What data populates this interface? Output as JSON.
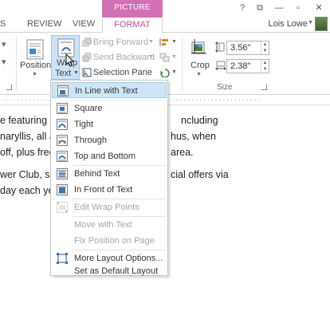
{
  "window": {
    "context_group": "PICTURE TOOLS",
    "controls": {
      "help": "?",
      "restore": "⧉",
      "minimize": "—",
      "maximize": "▫",
      "close": "✕"
    },
    "user_name": "Lois Lowe"
  },
  "tabs": {
    "review": "REVIEW",
    "view": "VIEW",
    "format": "FORMAT"
  },
  "ribbon": {
    "position_label": "Position",
    "wrap_text_line1": "Wrap",
    "wrap_text_line2": "Text",
    "bring_forward": "Bring Forward",
    "send_backward": "Send Backward",
    "selection_pane": "Selection Pane",
    "crop": "Crop",
    "height_value": "3.56\"",
    "width_value": "2.38\"",
    "size_group": "Size"
  },
  "document": {
    "lines": [
      "e featuring",
      "naryllis, all a",
      "off, plus free",
      "wer Club, si",
      "day each yea"
    ],
    "right_fragments": [
      "ncluding",
      "hus, when",
      "area.",
      "cial offers via"
    ]
  },
  "wrap_menu": {
    "items": [
      {
        "label": "In Line with Text",
        "accel": "I",
        "icon": "inline-icon",
        "enabled": true
      },
      {
        "label": "Square",
        "accel": "S",
        "icon": "square-wrap-icon",
        "enabled": true
      },
      {
        "label": "Tight",
        "accel": "T",
        "icon": "tight-wrap-icon",
        "enabled": true
      },
      {
        "label": "Through",
        "accel": "h",
        "icon": "through-wrap-icon",
        "enabled": true
      },
      {
        "label": "Top and Bottom",
        "accel": "o",
        "icon": "top-bottom-wrap-icon",
        "enabled": true
      },
      {
        "label": "Behind Text",
        "accel": "d",
        "icon": "behind-text-icon",
        "enabled": true
      },
      {
        "label": "In Front of Text",
        "accel": "N",
        "icon": "front-of-text-icon",
        "enabled": true
      },
      {
        "label": "Edit Wrap Points",
        "accel": "E",
        "icon": "edit-wrap-points-icon",
        "enabled": false
      },
      {
        "label": "Move with Text",
        "accel": "M",
        "enabled": false
      },
      {
        "label": "Fix Position on Page",
        "accel": "F",
        "enabled": false
      },
      {
        "label": "More Layout Options...",
        "accel": "L",
        "icon": "layout-options-icon",
        "enabled": true
      },
      {
        "label": "Set as Default Layout",
        "accel": "A",
        "enabled": true
      }
    ]
  }
}
